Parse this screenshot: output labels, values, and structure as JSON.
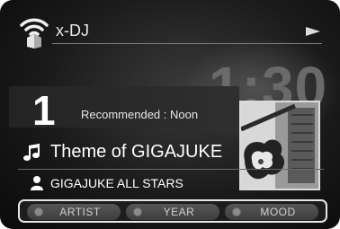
{
  "header": {
    "title": "x-DJ",
    "icon": "wifi-speaker-icon",
    "play_icon": "play-triangle-icon"
  },
  "clock": {
    "time": "1:30"
  },
  "recommendation": {
    "rank": "1",
    "text": "Recommended : Noon"
  },
  "track": {
    "title": "Theme of GIGAJUKE",
    "icon": "music-note-icon"
  },
  "artist": {
    "name": "GIGAJUKE ALL STARS",
    "icon": "person-icon"
  },
  "selector": {
    "buttons": [
      {
        "label": "ARTIST"
      },
      {
        "label": "YEAR"
      },
      {
        "label": "MOOD"
      }
    ]
  },
  "album_art": {
    "subject": "electric-guitar-image"
  },
  "colors": {
    "background": "#1a1a1a",
    "text": "#ffffff",
    "accent_border": "#e6e6e6"
  }
}
